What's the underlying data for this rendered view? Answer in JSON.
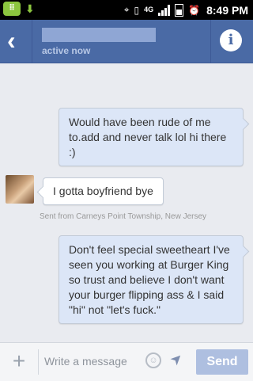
{
  "status_bar": {
    "notification_icons": [
      "bbm-icon",
      "download-icon"
    ],
    "network": "4G",
    "time": "8:49 PM"
  },
  "header": {
    "status": "active now"
  },
  "messages": [
    {
      "direction": "outgoing",
      "text": "Would have been rude of me to.add and never talk lol hi there :)"
    },
    {
      "direction": "incoming",
      "text": "I gotta boyfriend bye"
    },
    {
      "direction": "outgoing",
      "text": "Don't feel special sweetheart I've seen you working at Burger King so trust and believe I don't want your burger flipping ass & I said \"hi\" not \"let's fuck.\""
    }
  ],
  "location_note": "Sent from Carneys Point Township, New Jersey",
  "composer": {
    "placeholder": "Write a message",
    "send_label": "Send"
  },
  "colors": {
    "header": "#4a6aa5",
    "outgoing_bubble": "#dce6f7",
    "incoming_bubble": "#ffffff",
    "send_button": "#aebfe0"
  }
}
